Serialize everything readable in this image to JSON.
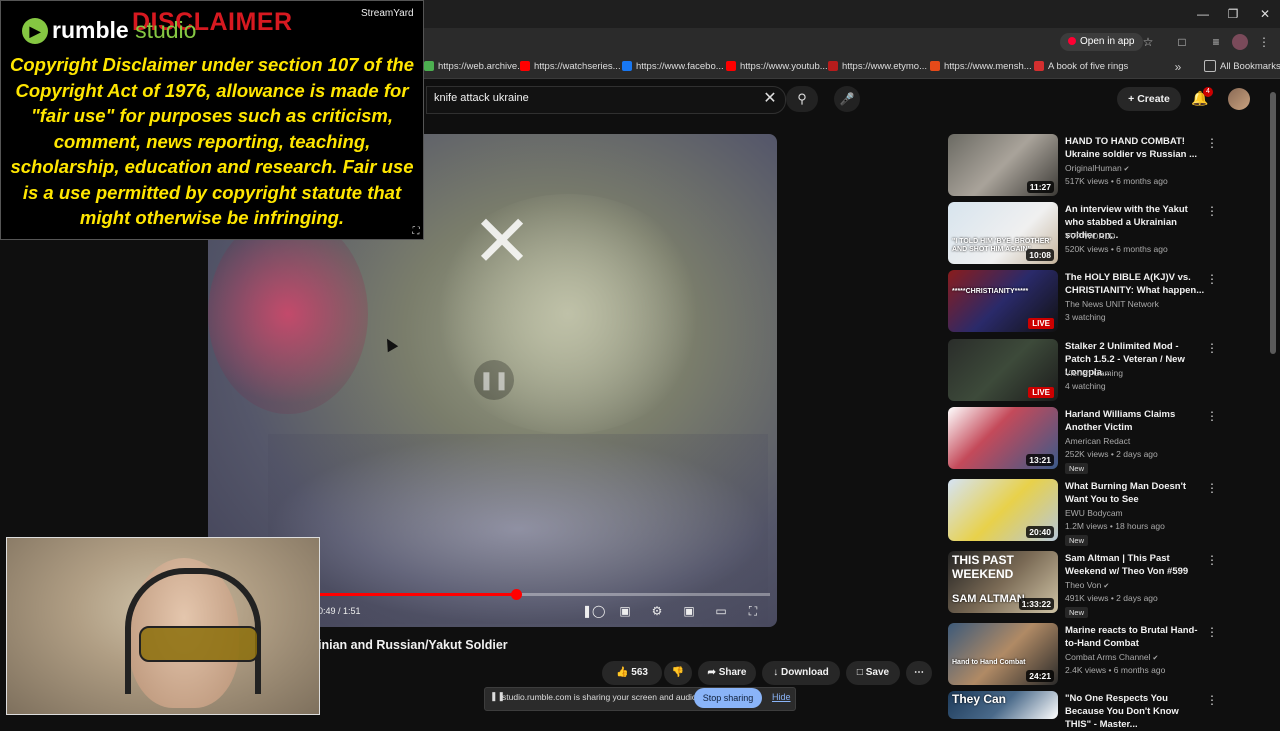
{
  "browser": {
    "open_in_app": "Open in app",
    "all_bookmarks": "All Bookmarks",
    "bookmarks": [
      {
        "label": "https://web.archive...",
        "color": "#4caf50"
      },
      {
        "label": "https://watchseries...",
        "color": "#ff0000"
      },
      {
        "label": "https://www.facebo...",
        "color": "#1877f2"
      },
      {
        "label": "https://www.youtub...",
        "color": "#ff0000"
      },
      {
        "label": "https://www.etymo...",
        "color": "#b71c1c"
      },
      {
        "label": "https://www.mensh...",
        "color": "#e64a19"
      },
      {
        "label": "A book of five rings",
        "color": "#d32f2f"
      }
    ]
  },
  "youtube": {
    "search_query": "knife attack ukraine",
    "create_label": "Create",
    "notification_count": "4",
    "player": {
      "time": "0:49 / 1:51",
      "progress": 0.44
    },
    "video_title": "inian and Russian/Yakut Soldier",
    "actions": {
      "likes": "563",
      "share": "Share",
      "download": "Download",
      "save": "Save"
    },
    "sidebar": [
      {
        "title": "HAND TO HAND COMBAT! Ukraine soldier vs Russian ...",
        "channel": "OriginalHuman",
        "verified": true,
        "stats": "517K views • 6 months ago",
        "duration": "11:27",
        "new": false,
        "live": false
      },
      {
        "title": "An interview with the Yakut who stabbed a Ukrainian soldier on...",
        "channel": "TVP WORLD",
        "verified": false,
        "stats": "520K views • 6 months ago",
        "duration": "10:08",
        "new": false,
        "live": false
      },
      {
        "title": "The HOLY BIBLE A(KJ)V vs. CHRISTIANITY:  What happen...",
        "channel": "The News UNIT Network",
        "verified": false,
        "stats": "3 watching",
        "duration": "LIVE",
        "new": false,
        "live": true
      },
      {
        "title": "Stalker 2 Unlimited Mod - Patch 1.5.2 - Veteran / New Longpla...",
        "channel": "Vierich Gaming",
        "verified": false,
        "stats": "4 watching",
        "duration": "LIVE",
        "new": false,
        "live": true
      },
      {
        "title": "Harland Williams Claims Another Victim",
        "channel": "American Redact",
        "verified": false,
        "stats": "252K views • 2 days ago",
        "duration": "13:21",
        "new": true,
        "live": false
      },
      {
        "title": "What Burning Man Doesn't Want You to See",
        "channel": "EWU Bodycam",
        "verified": false,
        "stats": "1.2M views • 18 hours ago",
        "duration": "20:40",
        "new": true,
        "live": false
      },
      {
        "title": "Sam Altman | This Past Weekend w/ Theo Von #599",
        "channel": "Theo Von",
        "verified": true,
        "stats": "491K views • 2 days ago",
        "duration": "1:33:22",
        "new": true,
        "live": false
      },
      {
        "title": "Marine reacts to Brutal Hand-to-Hand Combat",
        "channel": "Combat Arms Channel",
        "verified": true,
        "stats": "2.4K views • 6 months ago",
        "duration": "24:21",
        "new": false,
        "live": false
      },
      {
        "title": "\"No One Respects You Because You Don't Know THIS\" - Master...",
        "channel": "",
        "verified": false,
        "stats": "",
        "duration": "",
        "new": false,
        "live": false
      }
    ],
    "new_badge": "New",
    "thumb_texts": {
      "t1": "\"I TOLD HIM 'BYE, BROTHER' AND SHOT HIM AGAIN\"",
      "t2": "*****CHRISTIANITY*****",
      "t6": "THIS PAST WEEKEND",
      "t6b": "SAM ALTMAN",
      "t7": "Hand to Hand Combat",
      "t8": "They Can"
    }
  },
  "share_bar": {
    "message": "studio.rumble.com is sharing your screen and audio.",
    "stop": "Stop sharing",
    "hide": "Hide"
  },
  "overlay": {
    "rumble_logo": "rumble",
    "rumble_studio": "studio",
    "disclaimer_title": "DISCLAIMER",
    "streamyard": "StreamYard",
    "disclaimer_body": "Copyright Disclaimer under section 107 of the Copyright Act of 1976, allowance is made for \"fair use\" for purposes such as criticism, comment, news reporting, teaching, scholarship, education and research. Fair use is a use permitted by copyright statute that might otherwise be infringing."
  },
  "colors": {
    "youtube_red": "#ff0000",
    "rumble_green": "#85c742",
    "disclaimer_yellow": "#ffe600",
    "disclaimer_red": "#d71920",
    "share_blue": "#8ab4f8"
  }
}
